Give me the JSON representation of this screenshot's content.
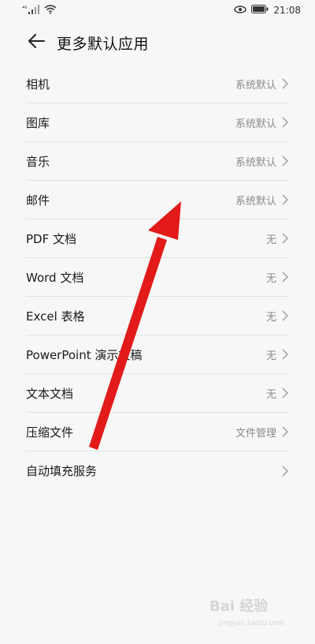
{
  "status_bar": {
    "signal_label": "⁴⁶",
    "time": "21:08",
    "icons": [
      "signal-icon",
      "wifi-icon",
      "eye-icon",
      "battery-icon"
    ]
  },
  "header": {
    "title": "更多默认应用",
    "back_icon": "back-arrow-icon"
  },
  "list": {
    "items": [
      {
        "label": "相机",
        "value": "系统默认"
      },
      {
        "label": "图库",
        "value": "系统默认"
      },
      {
        "label": "音乐",
        "value": "系统默认"
      },
      {
        "label": "邮件",
        "value": "系统默认"
      },
      {
        "label": "PDF 文档",
        "value": "无"
      },
      {
        "label": "Word 文档",
        "value": "无"
      },
      {
        "label": "Excel 表格",
        "value": "无"
      },
      {
        "label": "PowerPoint 演示文稿",
        "value": "无"
      },
      {
        "label": "文本文档",
        "value": "无"
      },
      {
        "label": "压缩文件",
        "value": "文件管理"
      },
      {
        "label": "自动填充服务",
        "value": ""
      }
    ]
  },
  "annotation": {
    "color": "#e21a1a",
    "type": "red-arrow"
  },
  "watermark": {
    "text": "Bai 经验",
    "subtext": "jingyan.baidu.com"
  }
}
